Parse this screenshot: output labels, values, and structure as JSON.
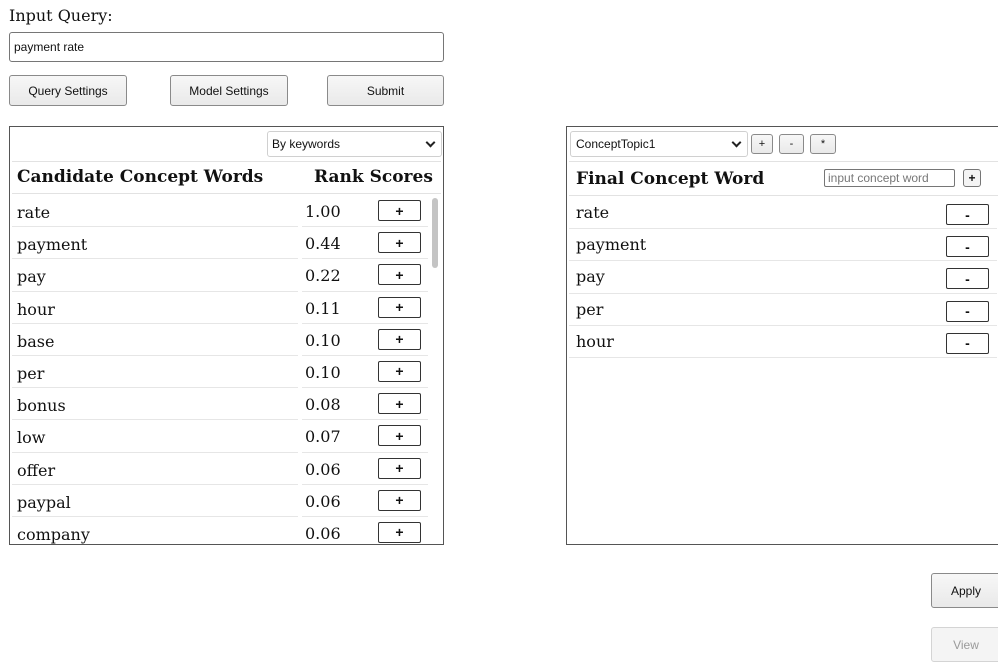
{
  "query": {
    "label": "Input Query:",
    "value": "payment rate",
    "buttons": {
      "query_settings": "Query Settings",
      "model_settings": "Model Settings",
      "submit": "Submit"
    }
  },
  "candidates": {
    "sort_by": "By keywords",
    "header_words": "Candidate Concept Words",
    "header_scores": "Rank Scores",
    "add_label": "+",
    "rows": [
      {
        "word": "rate",
        "score": "1.00"
      },
      {
        "word": "payment",
        "score": "0.44"
      },
      {
        "word": "pay",
        "score": "0.22"
      },
      {
        "word": "hour",
        "score": "0.11"
      },
      {
        "word": "base",
        "score": "0.10"
      },
      {
        "word": "per",
        "score": "0.10"
      },
      {
        "word": "bonus",
        "score": "0.08"
      },
      {
        "word": "low",
        "score": "0.07"
      },
      {
        "word": "offer",
        "score": "0.06"
      },
      {
        "word": "paypal",
        "score": "0.06"
      },
      {
        "word": "company",
        "score": "0.06"
      }
    ]
  },
  "final": {
    "topic": "ConceptTopic1",
    "topic_buttons": {
      "add": "+",
      "remove": "-",
      "star": "*"
    },
    "header": "Final Concept Word",
    "input_placeholder": "input concept word",
    "input_add": "+",
    "remove_label": "-",
    "words": [
      "rate",
      "payment",
      "pay",
      "per",
      "hour"
    ]
  },
  "actions": {
    "apply": "Apply",
    "view": "View"
  }
}
